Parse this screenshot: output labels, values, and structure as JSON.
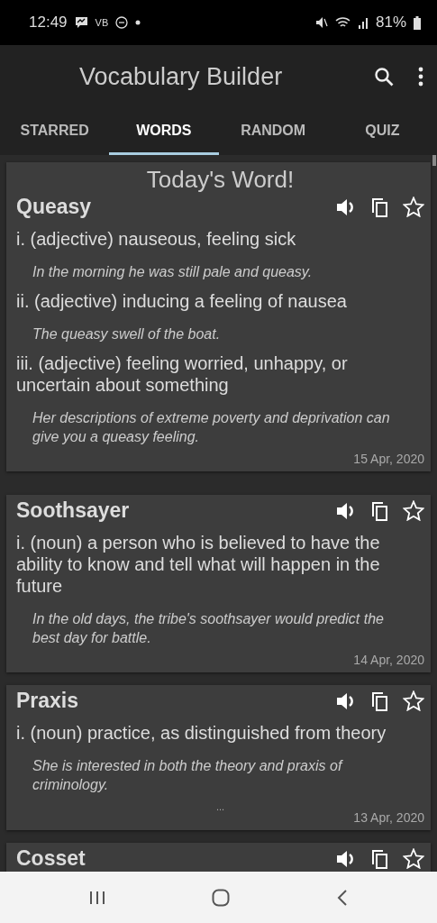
{
  "status_bar": {
    "time": "12:49",
    "carrier": "VB",
    "battery": "81%"
  },
  "app_bar": {
    "title": "Vocabulary Builder"
  },
  "tabs": [
    {
      "label": "STARRED",
      "selected": false
    },
    {
      "label": "WORDS",
      "selected": true
    },
    {
      "label": "RANDOM",
      "selected": false
    },
    {
      "label": "QUIZ",
      "selected": false
    }
  ],
  "words": [
    {
      "heading": "Today's Word!",
      "word": "Queasy",
      "starred": false,
      "senses": [
        {
          "definition": "i. (adjective) nauseous, feeling sick",
          "example": "In the morning he was still pale and queasy."
        },
        {
          "definition": "ii. (adjective) inducing a feeling of nausea",
          "example": "The queasy swell of the boat."
        },
        {
          "definition": "iii. (adjective) feeling worried, unhappy, or uncertain about something",
          "example": "Her descriptions of extreme poverty and deprivation can give you a queasy feeling."
        }
      ],
      "date": "15 Apr, 2020"
    },
    {
      "word": "Soothsayer",
      "starred": false,
      "senses": [
        {
          "definition": "i. (noun) a person who is believed to have the ability to know and tell what will happen in the future",
          "example": "In the old days, the tribe's soothsayer would predict the best day for battle."
        }
      ],
      "date": "14 Apr, 2020"
    },
    {
      "word": "Praxis",
      "starred": false,
      "senses": [
        {
          "definition": "i. (noun) practice, as distinguished from theory",
          "example": "She is interested in both the theory and praxis of criminology."
        }
      ],
      "more": "...",
      "date": "13 Apr, 2020"
    },
    {
      "word": "Cosset",
      "starred": false
    }
  ]
}
